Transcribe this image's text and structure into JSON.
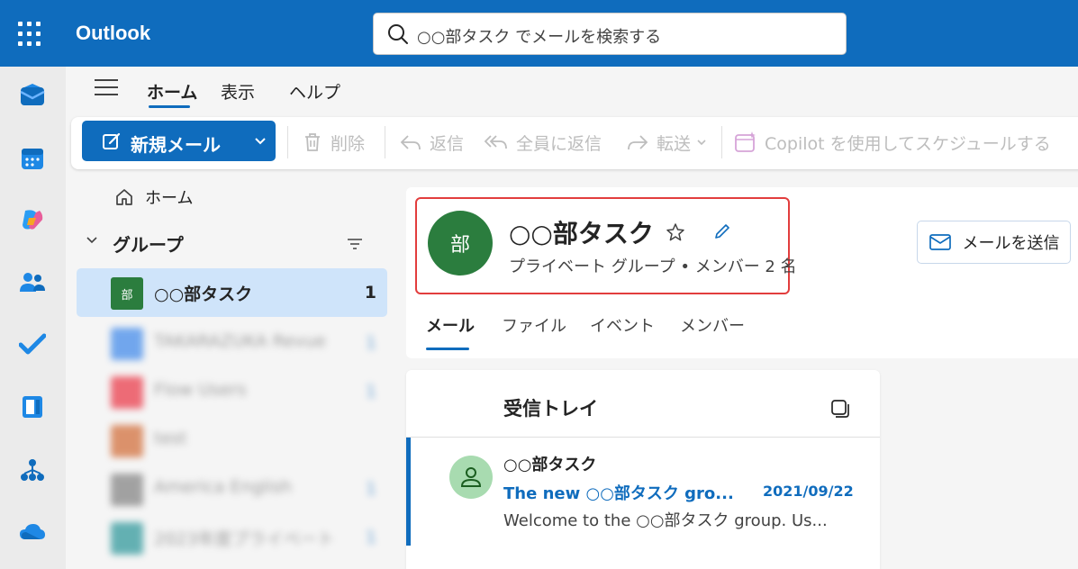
{
  "app": {
    "title": "Outlook"
  },
  "search": {
    "placeholder": "○○部タスク でメールを検索する"
  },
  "rail": {
    "items": [
      {
        "icon": "mail-icon"
      },
      {
        "icon": "calendar-icon"
      },
      {
        "icon": "copilot-icon"
      },
      {
        "icon": "people-icon"
      },
      {
        "icon": "todo-icon"
      },
      {
        "icon": "onenote-icon"
      },
      {
        "icon": "org-explorer-icon"
      },
      {
        "icon": "onedrive-icon"
      }
    ]
  },
  "tabs": [
    {
      "label": "ホーム",
      "active": true
    },
    {
      "label": "表示",
      "active": false
    },
    {
      "label": "ヘルプ",
      "active": false
    }
  ],
  "ribbon": {
    "new_mail": "新規メール",
    "delete": "削除",
    "reply": "返信",
    "reply_all": "全員に返信",
    "forward": "転送",
    "copilot": "Copilot を使用してスケジュールする"
  },
  "folder_pane": {
    "home": "ホーム",
    "groups_title": "グループ",
    "groups": [
      {
        "avatar_text": "部",
        "name": "○○部タスク",
        "count": "1",
        "color": "#2b7d3e",
        "selected": true
      },
      {
        "avatar_text": "",
        "name": "TAKARAZUKA Revue",
        "count": "1",
        "color": "#1a73e8",
        "blurred": true
      },
      {
        "avatar_text": "",
        "name": "Flow Users",
        "count": "1",
        "color": "#e81123",
        "blurred": true
      },
      {
        "avatar_text": "",
        "name": "test",
        "count": "",
        "color": "#ca5010",
        "blurred": true
      },
      {
        "avatar_text": "",
        "name": "America English",
        "count": "1",
        "color": "#6b6b6b",
        "blurred": true
      },
      {
        "avatar_text": "",
        "name": "2023年度プライベート",
        "count": "1",
        "color": "#038387",
        "blurred": true
      }
    ]
  },
  "group": {
    "avatar_text": "部",
    "name": "○○部タスク",
    "subtitle": "プライベート グループ • メンバー 2 名",
    "send_mail": "メールを送信",
    "tabs": [
      {
        "label": "メール",
        "active": true
      },
      {
        "label": "ファイル",
        "active": false
      },
      {
        "label": "イベント",
        "active": false
      },
      {
        "label": "メンバー",
        "active": false
      }
    ]
  },
  "message_list": {
    "title": "受信トレイ",
    "messages": [
      {
        "sender": "○○部タスク",
        "subject": "The new ○○部タスク gro...",
        "date": "2021/09/22",
        "preview": "Welcome to the ○○部タスク group. Us..."
      }
    ]
  },
  "colors": {
    "brand": "#0f6cbd",
    "highlight_box": "#e23d3d",
    "group_avatar": "#2b7d3e"
  }
}
